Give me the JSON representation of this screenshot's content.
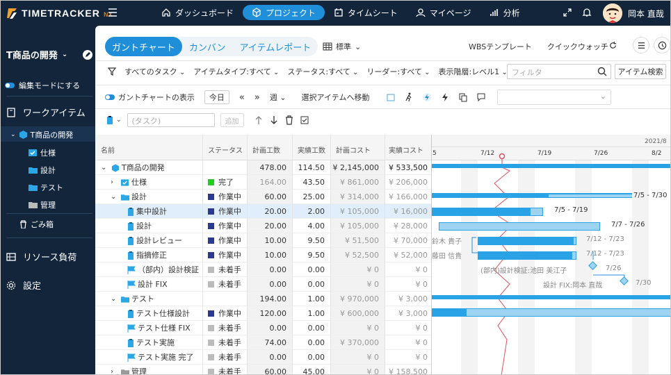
{
  "app": {
    "logo": "TIMETRACKER",
    "logo_suffix": "NX",
    "user_name": "岡本 直哉"
  },
  "nav": [
    {
      "label": "ダッシュボード",
      "icon": "home-icon"
    },
    {
      "label": "プロジェクト",
      "icon": "cube-icon",
      "active": true
    },
    {
      "label": "タイムシート",
      "icon": "calendar-icon"
    },
    {
      "label": "マイページ",
      "icon": "person-icon"
    },
    {
      "label": "分析",
      "icon": "chart-icon"
    }
  ],
  "sidebar": {
    "project": "T商品の開発",
    "edit_mode": "編集モードにする",
    "work_items": "ワークアイテム",
    "tree": [
      {
        "label": "T商品の開発"
      },
      {
        "label": "仕様"
      },
      {
        "label": "設計"
      },
      {
        "label": "テスト"
      },
      {
        "label": "管理"
      }
    ],
    "trash": "ごみ箱",
    "resource": "リソース負荷",
    "settings": "設定"
  },
  "tabs": [
    {
      "label": "ガントチャート",
      "active": true
    },
    {
      "label": "カンバン"
    },
    {
      "label": "アイテムレポート"
    }
  ],
  "view_select": "標準",
  "right_buttons": {
    "wbs": "WBSテンプレート",
    "quick": "クイックウォッチ"
  },
  "filters": [
    "すべてのタスク",
    "アイテムタイプ:すべて",
    "ステータス:すべて",
    "リーダー:すべて",
    "表示階層:レベル1"
  ],
  "filter_placeholder": "フィルタ",
  "item_search": "アイテム検索",
  "toolbar2": {
    "show_gantt": "ガントチャートの表示",
    "today": "今日",
    "unit": "週",
    "move": "選択アイテムへ移動"
  },
  "toolbar3": {
    "task_placeholder": "(タスク)",
    "add": "追加"
  },
  "columns": {
    "name": "名前",
    "status": "ステータス",
    "plan_hours": "計画工数",
    "actual_hours": "実績工数",
    "plan_cost": "計画コスト",
    "actual_cost": "実績コスト"
  },
  "rows": [
    {
      "name": "T商品の開発",
      "status": "",
      "status_color": "",
      "plan_hours": "478.00",
      "actual_hours": "114.50",
      "plan_cost": "¥ 2,145,000",
      "actual_cost": "¥ 533,500"
    },
    {
      "name": "仕様",
      "status": "完了",
      "status_color": "#22cc22",
      "plan_hours": "164.00",
      "actual_hours": "43.50",
      "plan_cost": "¥ 861,000",
      "actual_cost": "¥ 206,000"
    },
    {
      "name": "設計",
      "status": "作業中",
      "status_color": "#2b3a8f",
      "plan_hours": "60.00",
      "actual_hours": "25.00",
      "plan_cost": "¥ 314,000",
      "actual_cost": "¥ 166,000"
    },
    {
      "name": "集中設計",
      "status": "作業中",
      "status_color": "#2b3a8f",
      "plan_hours": "20.00",
      "actual_hours": "2.00",
      "plan_cost": "¥ 105,000",
      "actual_cost": "¥ 16,000"
    },
    {
      "name": "設計",
      "status": "作業中",
      "status_color": "#2b3a8f",
      "plan_hours": "20.00",
      "actual_hours": "4.00",
      "plan_cost": "¥ 105,000",
      "actual_cost": "¥ 28,000"
    },
    {
      "name": "設計レビュー",
      "status": "作業中",
      "status_color": "#2b3a8f",
      "plan_hours": "10.00",
      "actual_hours": "9.50",
      "plan_cost": "¥ 51,500",
      "actual_cost": "¥ 70,000"
    },
    {
      "name": "指摘修正",
      "status": "作業中",
      "status_color": "#2b3a8f",
      "plan_hours": "10.00",
      "actual_hours": "9.50",
      "plan_cost": "¥ 52,500",
      "actual_cost": "¥ 52,000"
    },
    {
      "name": "（部内）設計検証",
      "status": "未着手",
      "status_color": "#bbbbbb",
      "plan_hours": "0.00",
      "actual_hours": "0.00",
      "plan_cost": "¥ 0",
      "actual_cost": "¥ 0"
    },
    {
      "name": "設計 FIX",
      "status": "未着手",
      "status_color": "#bbbbbb",
      "plan_hours": "0.00",
      "actual_hours": "0.00",
      "plan_cost": "¥ 0",
      "actual_cost": "¥ 0"
    },
    {
      "name": "テスト",
      "status": "",
      "status_color": "",
      "plan_hours": "194.00",
      "actual_hours": "1.00",
      "plan_cost": "¥ 970,000",
      "actual_cost": "¥ 3,000"
    },
    {
      "name": "テスト仕様設計",
      "status": "作業中",
      "status_color": "#2b3a8f",
      "plan_hours": "120.00",
      "actual_hours": "1.00",
      "plan_cost": "¥ 600,000",
      "actual_cost": "¥ 3,000"
    },
    {
      "name": "テスト仕様 FIX",
      "status": "未着手",
      "status_color": "#bbbbbb",
      "plan_hours": "0.00",
      "actual_hours": "0.00",
      "plan_cost": "¥ 0",
      "actual_cost": "¥ 0"
    },
    {
      "name": "テスト実施",
      "status": "未着手",
      "status_color": "#bbbbbb",
      "plan_hours": "74.00",
      "actual_hours": "0.00",
      "plan_cost": "¥ 370,000",
      "actual_cost": "¥ 0"
    },
    {
      "name": "テスト実施 完了",
      "status": "未着手",
      "status_color": "#bbbbbb",
      "plan_hours": "0.00",
      "actual_hours": "0.00",
      "plan_cost": "¥ 0",
      "actual_cost": "¥ 0"
    },
    {
      "name": "管理",
      "status": "未着手",
      "status_color": "#bbbbbb",
      "plan_hours": "60.00",
      "actual_hours": "45.00",
      "plan_cost": "¥ 0",
      "actual_cost": "¥ 158,500"
    }
  ],
  "gantt": {
    "year_label": "2021/8",
    "weeks": [
      "5",
      "7/12",
      "7/19",
      "7/26",
      "8/2"
    ],
    "labels": {
      "l1": "7/5 - 7/30",
      "l2": "7/5 - 7/19",
      "l3": "7/7 - 7/26",
      "l4": "鈴木 貴子",
      "l5": "7/12 - 7/23",
      "l6": "藤田 信貴",
      "l7": "7/12 - 7/23",
      "l8": "(部内)設計検証:池田 美江子",
      "l9": "7/26",
      "l10": "設計 FIX:岡本 直哉",
      "l11": "7/30"
    },
    "colors": {
      "bar": "#29a3e6",
      "bar_light": "#9ed3f2",
      "today": "#e0505a"
    }
  }
}
